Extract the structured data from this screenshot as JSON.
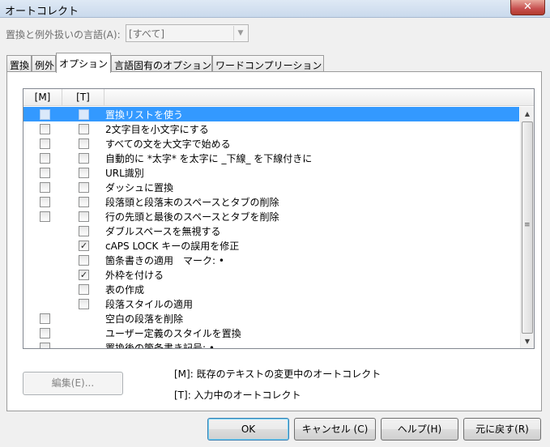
{
  "window": {
    "title": "オートコレクト",
    "close_label": "✕"
  },
  "language": {
    "label": "置換と例外扱いの言語(A):",
    "value": "[すべて]"
  },
  "tabs": [
    {
      "label": "置換"
    },
    {
      "label": "例外"
    },
    {
      "label": "オプション"
    },
    {
      "label": "言語固有のオプション"
    },
    {
      "label": "ワードコンプリーション"
    }
  ],
  "list": {
    "headers": {
      "m": "[M]",
      "t": "[T]"
    },
    "rows": [
      {
        "label": "置換リストを使う",
        "m": false,
        "t": false
      },
      {
        "label": "2文字目を小文字にする",
        "m": false,
        "t": false
      },
      {
        "label": "すべての文を大文字で始める",
        "m": false,
        "t": false
      },
      {
        "label": "自動的に *太字* を太字に _下線_ を下線付きに",
        "m": false,
        "t": false
      },
      {
        "label": "URL識別",
        "m": false,
        "t": false
      },
      {
        "label": "ダッシュに置換",
        "m": false,
        "t": false
      },
      {
        "label": "段落頭と段落末のスペースとタブの削除",
        "m": false,
        "t": false
      },
      {
        "label": "行の先頭と最後のスペースとタブを削除",
        "m": false,
        "t": false
      },
      {
        "label": "ダブルスペースを無視する",
        "m": null,
        "t": false
      },
      {
        "label": "cAPS LOCK キーの誤用を修正",
        "m": null,
        "t": true
      },
      {
        "label": "箇条書きの適用　マーク: •",
        "m": null,
        "t": false
      },
      {
        "label": "外枠を付ける",
        "m": null,
        "t": true
      },
      {
        "label": "表の作成",
        "m": null,
        "t": false
      },
      {
        "label": "段落スタイルの適用",
        "m": null,
        "t": false
      },
      {
        "label": "空白の段落を削除",
        "m": false,
        "t": null
      },
      {
        "label": "ユーザー定義のスタイルを置換",
        "m": false,
        "t": null
      },
      {
        "label": "置換後の箇条書き記号: •",
        "m": false,
        "t": null
      }
    ]
  },
  "edit_button": "編集(E)...",
  "legend": {
    "m": "[M]: 既存のテキストの変更中のオートコレクト",
    "t": "[T]: 入力中のオートコレクト"
  },
  "buttons": {
    "ok": "OK",
    "cancel": "キャンセル (C)",
    "help": "ヘルプ(H)",
    "reset": "元に戻す(R)"
  },
  "icons": {
    "scroll_up": "scroll-up-arrow-icon",
    "scroll_down": "scroll-down-arrow-icon",
    "grip": "scroll-grip-icon",
    "checkmark": "checkmark-icon",
    "dropdown": "chevron-down-icon"
  },
  "colors": {
    "selection": "#3399ff",
    "close": "#c75050"
  }
}
